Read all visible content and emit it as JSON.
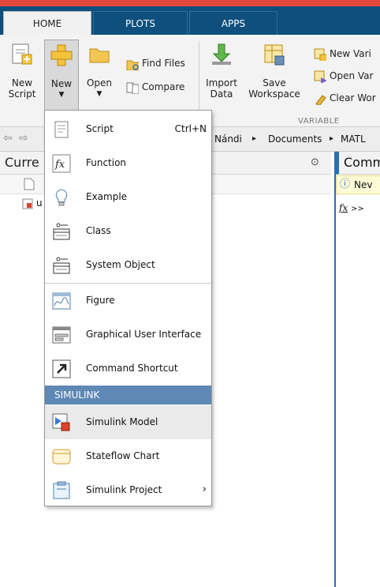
{
  "tabs": [
    {
      "label": "HOME",
      "active": true
    },
    {
      "label": "PLOTS",
      "active": false
    },
    {
      "label": "APPS",
      "active": false
    }
  ],
  "ribbon": {
    "new_script_line1": "New",
    "new_script_line2": "Script",
    "new_label": "New",
    "open_label": "Open",
    "find_files": "Find Files",
    "compare": "Compare",
    "import_line1": "Import",
    "import_line2": "Data",
    "save_line1": "Save",
    "save_line2": "Workspace",
    "new_variable": "New Vari",
    "open_variable": "Open Var",
    "clear_workspace": "Clear Wor",
    "group_variable": "VARIABLE"
  },
  "address": {
    "crumb_user": "Nándi",
    "crumb_documents": "Documents",
    "crumb_matlab": "MATL",
    "separator": "▸"
  },
  "current_folder": {
    "title": "Curre",
    "file_row_label": "u"
  },
  "command_window": {
    "title": "Comm",
    "banner_text": "Nev",
    "prompt_fx": "fx",
    "prompt": ">>"
  },
  "menu": {
    "items": [
      {
        "label": "Script",
        "shortcut": "Ctrl+N",
        "icon": "script-icon"
      },
      {
        "label": "Function",
        "icon": "function-icon"
      },
      {
        "label": "Example",
        "icon": "example-lightbulb-icon"
      },
      {
        "label": "Class",
        "icon": "class-icon"
      },
      {
        "label": "System Object",
        "icon": "system-object-icon"
      },
      {
        "label": "Figure",
        "icon": "figure-icon"
      },
      {
        "label": "Graphical User Interface",
        "icon": "gui-icon"
      },
      {
        "label": "Command Shortcut",
        "icon": "command-shortcut-icon"
      },
      {
        "label": "Simulink Model",
        "icon": "simulink-model-icon"
      },
      {
        "label": "Stateflow Chart",
        "icon": "stateflow-chart-icon"
      },
      {
        "label": "Simulink Project",
        "icon": "simulink-project-icon",
        "submenu_arrow": "›"
      }
    ],
    "section_simulink": "SIMULINK"
  },
  "colors": {
    "tab_bar": "#0e4f7e",
    "section_header": "#5e88b5",
    "title_strip": "#e2473b",
    "accent_blue": "#2b6fb3"
  }
}
